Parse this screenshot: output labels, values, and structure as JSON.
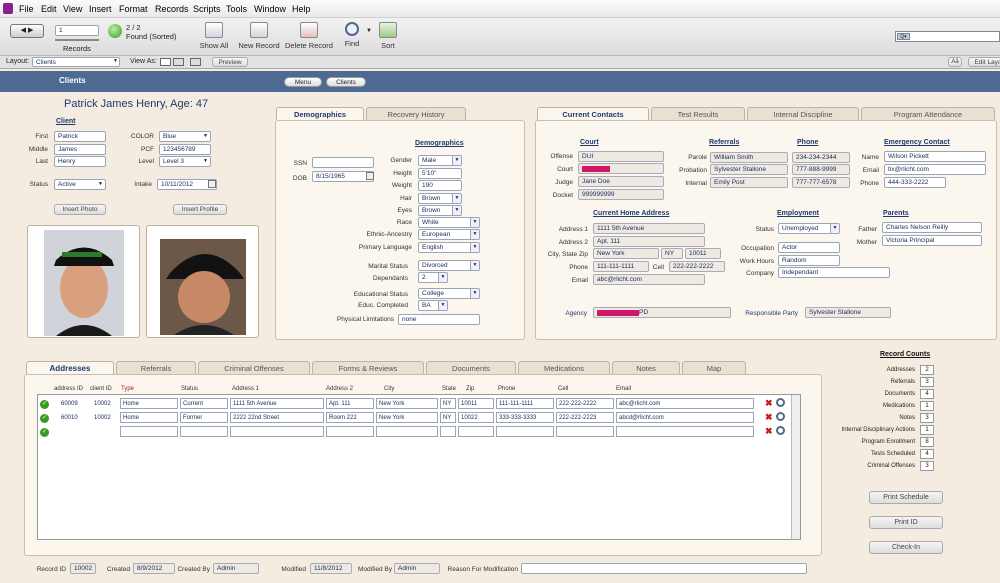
{
  "menu": [
    "File",
    "Edit",
    "View",
    "Insert",
    "Format",
    "Records",
    "Scripts",
    "Tools",
    "Window",
    "Help"
  ],
  "toolbar": {
    "record_num": "1",
    "records_label": "Records",
    "found": "2 / 2",
    "found_sorted": "Found (Sorted)",
    "show_all": "Show All",
    "new_record": "New Record",
    "delete_record": "Delete Record",
    "find": "Find",
    "sort": "Sort"
  },
  "layoutbar": {
    "layout_label": "Layout:",
    "layout_value": "Clients",
    "view_as": "View As:",
    "preview": "Preview",
    "edit_layout": "Edit Layo",
    "aa": "Aâ"
  },
  "header": {
    "title": "Clients",
    "menu_btn": "Menu",
    "clients_btn": "Clients"
  },
  "client": {
    "name_heading": "Patrick James Henry, Age: 47",
    "section": "Client",
    "first_label": "First",
    "first": "Patrick",
    "middle_label": "Middle",
    "middle": "James",
    "last_label": "Last",
    "last": "Henry",
    "color_label": "COLOR",
    "color": "Blue",
    "pcf_label": "PCF",
    "pcf": "123456789",
    "level_label": "Level",
    "level": "Level 3",
    "status_label": "Status",
    "status": "Active",
    "intake_label": "Intake",
    "intake": "10/11/2012",
    "insert_photo": "Insert Photo",
    "insert_profile": "Insert Profile"
  },
  "demo": {
    "tab1": "Demographics",
    "tab2": "Recovery History",
    "section": "Demographics",
    "ssn_label": "SSN",
    "ssn": "",
    "dob_label": "DOB",
    "dob": "8/15/1965",
    "gender_label": "Gender",
    "gender": "Male",
    "height_label": "Height",
    "height": "5'10\"",
    "weight_label": "Weight",
    "weight": "190",
    "hair_label": "Hair",
    "hair": "Brown",
    "eyes_label": "Eyes",
    "eyes": "Brown",
    "race_label": "Race",
    "race": "White",
    "ethnic_label": "Ethnic-Ancestry",
    "ethnic": "European",
    "lang_label": "Primary Language",
    "lang": "English",
    "marital_label": "Marital Status",
    "marital": "Divorced",
    "dep_label": "Dependants",
    "dep": "2",
    "edstat_label": "Educational Status",
    "edstat": "College",
    "educ_label": "Educ. Completed",
    "educ": "BA",
    "phys_label": "Physical Limitations",
    "phys": "none"
  },
  "contacts": {
    "tabs": [
      "Current Contacts",
      "Test Results",
      "Internal Discipline",
      "Program Attendance"
    ],
    "court_section": "Court",
    "offense_label": "Offense",
    "offense": "DUI",
    "court_label": "Court",
    "judge_label": "Judge",
    "judge": "Jane Doe",
    "docket_label": "Docket",
    "docket": "999999999",
    "referrals_section": "Referrals",
    "phone_section": "Phone",
    "parole_label": "Parole",
    "parole": "William Smith",
    "parole_phone": "234-234-2344",
    "probation_label": "Probation",
    "probation": "Sylvester Stallone",
    "probation_phone": "777-888-9999",
    "internal_label": "Internal",
    "internal": "Emily Post",
    "internal_phone": "777-777-6578",
    "emergency_section": "Emergency Contact",
    "ename_label": "Name",
    "ename": "Wilson Pickett",
    "eemail_label": "Email",
    "eemail": "tix@rlicht.com",
    "ephone_label": "Phone",
    "ephone": "444-333-2222",
    "address_section": "Current Home Address",
    "addr1_label": "Address 1",
    "addr1": "1111 5th Avenue",
    "addr2_label": "Address 2",
    "addr2": "Apt. 111",
    "csz_label": "City, State Zip",
    "city": "New York",
    "state": "NY",
    "zip": "10011",
    "phone_label": "Phone",
    "phone": "111-111-1111",
    "cell_label": "Cell",
    "cell": "222-222-2222",
    "email_label": "Email",
    "email": "abc@rlicht.com",
    "employment_section": "Employment",
    "emp_status_label": "Status",
    "emp_status": "Unemployed",
    "occupation_label": "Occupation",
    "occupation": "Actor",
    "workhours_label": "Work Hours",
    "workhours": "Random",
    "company_label": "Company",
    "company": "Independant",
    "parents_section": "Parents",
    "father_label": "Father",
    "father": "Charles Nelson Reilly",
    "mother_label": "Mother",
    "mother": "Victoria Principal",
    "agency_label": "Agency",
    "agency_suffix": "PD",
    "resp_label": "Responsible Party",
    "resp": "Sylvester Stallone"
  },
  "bottom_tabs": [
    "Addresses",
    "Referrals",
    "Criminal Offenses",
    "Forms & Reviews",
    "Documents",
    "Medications",
    "Notes",
    "Map"
  ],
  "table": {
    "headers": [
      "address ID",
      "client ID",
      "Type",
      "Status",
      "Address 1",
      "Address 2",
      "City",
      "State",
      "Zip",
      "Phone",
      "Cell",
      "Email"
    ],
    "rows": [
      [
        "60009",
        "10002",
        "Home",
        "Current",
        "1111 5th Avenue",
        "Apt. 111",
        "New York",
        "NY",
        "10011",
        "111-111-1111",
        "222-222-2222",
        "abc@rlicht.com"
      ],
      [
        "60010",
        "10002",
        "Home",
        "Former",
        "2222 22nd Street",
        "Room 222",
        "New York",
        "NY",
        "10022",
        "333-333-3333",
        "222-222-2223",
        "abcd@rlicht.com"
      ]
    ]
  },
  "record_counts": {
    "title": "Record Counts",
    "items": [
      {
        "label": "Addresses",
        "value": "2"
      },
      {
        "label": "Referrals",
        "value": "3"
      },
      {
        "label": "Documents",
        "value": "4"
      },
      {
        "label": "Medications",
        "value": "1"
      },
      {
        "label": "Notes",
        "value": "3"
      },
      {
        "label": "Internal Disciplinary Actions",
        "value": "1"
      },
      {
        "label": "Program Enrollment",
        "value": "8"
      },
      {
        "label": "Tests Scheduled",
        "value": "4"
      },
      {
        "label": "Criminal Offenses",
        "value": "3"
      }
    ]
  },
  "actions": {
    "print_schedule": "Print Schedule",
    "print_id": "Print ID",
    "check_in": "Check-In"
  },
  "footer": {
    "record_id_label": "Record ID",
    "record_id": "10002",
    "created_label": "Created",
    "created": "8/9/2012",
    "created_by_label": "Created By",
    "created_by": "Admin",
    "modified_label": "Modified",
    "modified": "11/8/2012",
    "modified_by_label": "Modified By",
    "modified_by": "Admin",
    "reason_label": "Reason For Modification"
  }
}
